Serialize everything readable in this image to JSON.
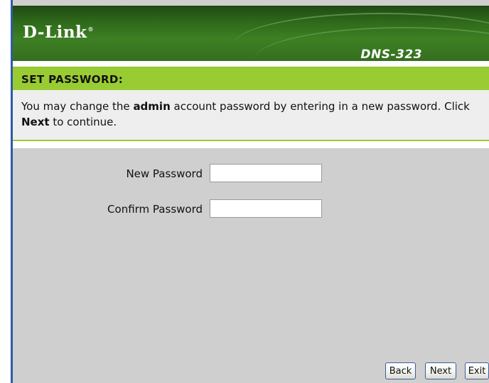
{
  "header": {
    "brand": "D-Link",
    "brand_mark": "®",
    "model": "DNS-323"
  },
  "section": {
    "title": "SET PASSWORD:",
    "description_part1": "You may change the ",
    "description_bold1": "admin",
    "description_part2": " account password by entering in a new password. Click ",
    "description_bold2": "Next",
    "description_part3": " to continue."
  },
  "form": {
    "new_password_label": "New Password",
    "new_password_value": "",
    "confirm_password_label": "Confirm Password",
    "confirm_password_value": ""
  },
  "buttons": {
    "back": "Back",
    "next": "Next",
    "exit": "Exit"
  },
  "colors": {
    "header_green": "#2f6a1b",
    "title_bar_green": "#99cc33",
    "background_gray": "#cfcfcf",
    "frame_blue": "#2f5aa8"
  }
}
